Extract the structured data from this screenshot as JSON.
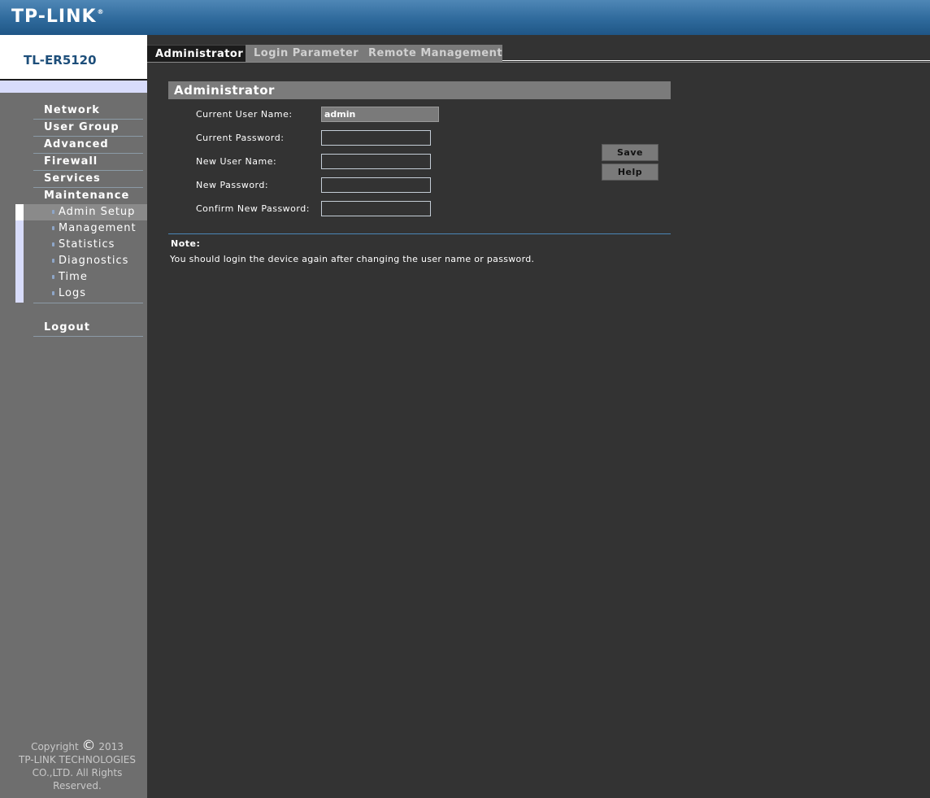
{
  "header": {
    "logo_text": "TP-LINK",
    "logo_mark": "®"
  },
  "sidebar": {
    "model": "TL-ER5120",
    "menu": [
      {
        "label": "Network"
      },
      {
        "label": "User Group"
      },
      {
        "label": "Advanced"
      },
      {
        "label": "Firewall"
      },
      {
        "label": "Services"
      },
      {
        "label": "Maintenance"
      }
    ],
    "submenu": [
      {
        "label": "Admin Setup",
        "active": true
      },
      {
        "label": "Management"
      },
      {
        "label": "Statistics"
      },
      {
        "label": "Diagnostics"
      },
      {
        "label": "Time"
      },
      {
        "label": "Logs"
      }
    ],
    "logout": "Logout",
    "copyright": {
      "word": "Copyright",
      "symbol": "©",
      "year": "2013",
      "line2": "TP-LINK TECHNOLOGIES",
      "line3": "CO.,LTD. All Rights",
      "line4": "Reserved."
    }
  },
  "tabs": [
    {
      "label": "Administrator",
      "active": true
    },
    {
      "label": "Login Parameter"
    },
    {
      "label": "Remote Management"
    }
  ],
  "form": {
    "title": "Administrator",
    "fields": {
      "current_user_label": "Current User Name:",
      "current_user_value": "admin",
      "current_password_label": "Current Password:",
      "new_user_label": "New User Name:",
      "new_password_label": "New Password:",
      "confirm_password_label": "Confirm New Password:"
    },
    "save_label": "Save",
    "help_label": "Help",
    "note_title": "Note:",
    "note_text": "You should login the device again after changing the user name or password."
  }
}
